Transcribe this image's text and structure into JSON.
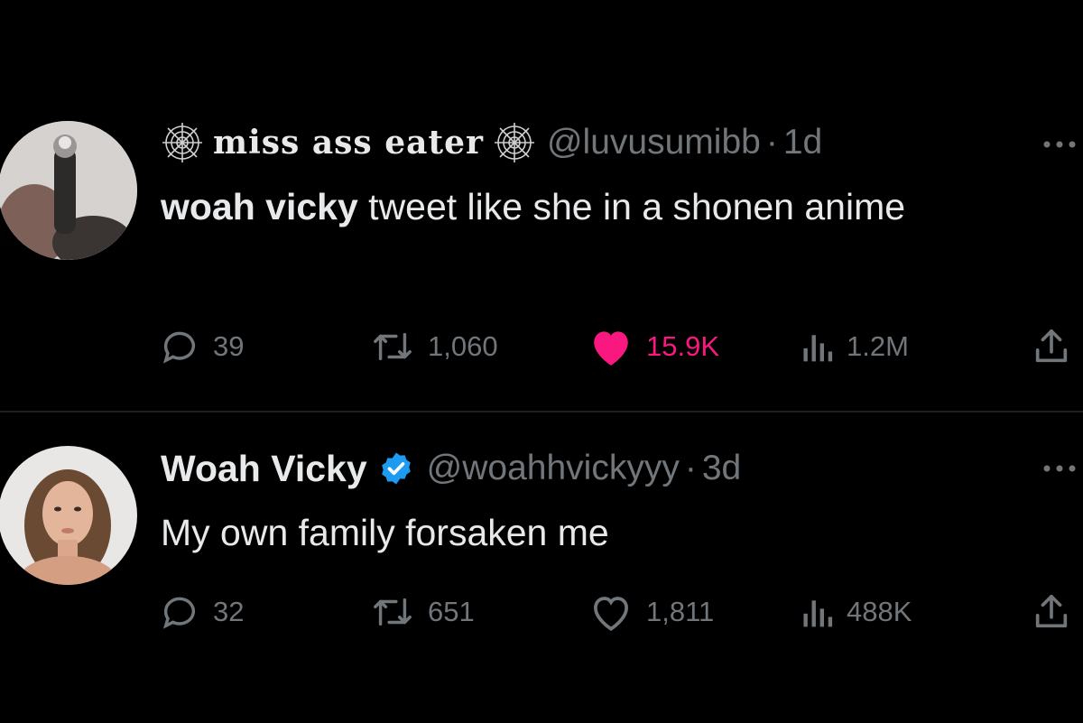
{
  "tweets": [
    {
      "display_name": "miss ass eater",
      "name_icon": "spider-web-icon",
      "handle": "@luvusumibb",
      "separator": "·",
      "time": "1d",
      "body_bold": "woah vicky",
      "body_rest": " tweet like she in a shonen anime",
      "replies": "39",
      "retweets": "1,060",
      "likes": "15.9K",
      "liked": true,
      "views": "1.2M"
    },
    {
      "display_name": "Woah Vicky",
      "verified": true,
      "handle": "@woahhvickyyy",
      "separator": "·",
      "time": "3d",
      "body": "My own family forsaken me",
      "replies": "32",
      "retweets": "651",
      "likes": "1,811",
      "liked": false,
      "views": "488K"
    }
  ],
  "colors": {
    "background": "#000000",
    "text": "#e7e9ea",
    "muted": "#71767b",
    "like_active": "#f91880",
    "verified": "#1d9bf0"
  }
}
